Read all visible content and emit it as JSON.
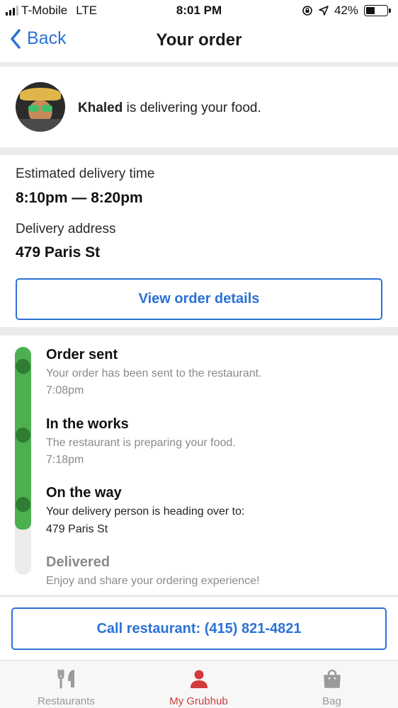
{
  "status_bar": {
    "carrier": "T-Mobile",
    "network": "LTE",
    "time": "8:01 PM",
    "battery": "42%",
    "battery_level": 0.42
  },
  "nav": {
    "back_label": "Back",
    "title": "Your order"
  },
  "driver": {
    "name": "Khaled",
    "message": " is delivering your food."
  },
  "delivery": {
    "eta_label": "Estimated delivery time",
    "eta_value": "8:10pm — 8:20pm",
    "address_label": "Delivery address",
    "address_value": "479 Paris St",
    "details_button": "View order details"
  },
  "timeline": {
    "progress": 0.8,
    "steps": [
      {
        "title": "Order sent",
        "desc": "Your order has been sent to the restaurant.",
        "time": "7:08pm",
        "status": "done"
      },
      {
        "title": "In the works",
        "desc": "The restaurant is preparing your food.",
        "time": "7:18pm",
        "status": "done"
      },
      {
        "title": "On the way",
        "desc": "Your delivery person is heading over to:",
        "time": "479 Paris St",
        "status": "current"
      },
      {
        "title": "Delivered",
        "desc": "Enjoy and share your ordering experience!",
        "time": "",
        "status": "pending"
      }
    ]
  },
  "call_button": "Call restaurant: (415) 821-4821",
  "tabs": [
    {
      "label": "Restaurants",
      "icon": "fork-knife-icon",
      "active": false
    },
    {
      "label": "My Grubhub",
      "icon": "person-icon",
      "active": true
    },
    {
      "label": "Bag",
      "icon": "bag-icon",
      "active": false
    }
  ],
  "colors": {
    "accent_blue": "#2b72d6",
    "progress_green": "#4caf50",
    "active_tab_red": "#d23b3b"
  }
}
